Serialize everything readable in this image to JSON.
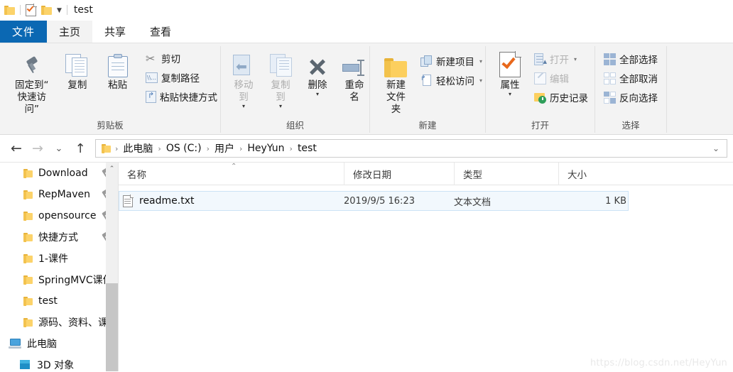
{
  "titlebar": {
    "title": "test",
    "icons": [
      "folder-icon",
      "properties-icon",
      "folder-icon",
      "dropdown-caret-icon"
    ],
    "caret": "▼"
  },
  "tabs": [
    {
      "label": "文件",
      "name": "tab-file",
      "active": false,
      "accent": "#0b68b3"
    },
    {
      "label": "主页",
      "name": "tab-home",
      "active": true
    },
    {
      "label": "共享",
      "name": "tab-share",
      "active": false
    },
    {
      "label": "查看",
      "name": "tab-view",
      "active": false
    }
  ],
  "ribbon": {
    "groups": [
      {
        "name": "剪贴板",
        "big": [
          {
            "label1": "固定到“",
            "label2": "快速访问”",
            "icon": "pin-icon"
          },
          {
            "label1": "复制",
            "label2": "",
            "icon": "copy-icon"
          },
          {
            "label1": "粘贴",
            "label2": "",
            "icon": "paste-icon"
          }
        ],
        "small": [
          {
            "label": "剪切",
            "icon": "scissors-icon"
          },
          {
            "label": "复制路径",
            "icon": "copy-path-icon"
          },
          {
            "label": "粘贴快捷方式",
            "icon": "paste-shortcut-icon"
          }
        ]
      },
      {
        "name": "组织",
        "big": [
          {
            "label1": "移动到",
            "label2": "",
            "icon": "move-to-icon",
            "dropdown": true,
            "dim": true
          },
          {
            "label1": "复制到",
            "label2": "",
            "icon": "copy-to-icon",
            "dropdown": true,
            "dim": true
          },
          {
            "label1": "删除",
            "label2": "",
            "icon": "delete-icon",
            "dropdown": true
          },
          {
            "label1": "重命名",
            "label2": "",
            "icon": "rename-icon"
          }
        ],
        "small": []
      },
      {
        "name": "新建",
        "big": [
          {
            "label1": "新建",
            "label2": "文件夹",
            "icon": "new-folder-icon"
          }
        ],
        "small": [
          {
            "label": "新建项目",
            "icon": "new-item-icon",
            "caret": "▾"
          },
          {
            "label": "轻松访问",
            "icon": "easy-access-icon",
            "caret": "▾"
          }
        ]
      },
      {
        "name": "打开",
        "big": [
          {
            "label1": "属性",
            "label2": "",
            "icon": "properties-icon",
            "dropdown": true
          }
        ],
        "small": [
          {
            "label": "打开",
            "icon": "open-icon",
            "caret": "▾",
            "dim": true
          },
          {
            "label": "编辑",
            "icon": "edit-icon",
            "dim": true
          },
          {
            "label": "历史记录",
            "icon": "history-icon"
          }
        ]
      },
      {
        "name": "选择",
        "big": [],
        "small": [
          {
            "label": "全部选择",
            "icon": "select-all-icon"
          },
          {
            "label": "全部取消",
            "icon": "select-none-icon"
          },
          {
            "label": "反向选择",
            "icon": "invert-selection-icon"
          }
        ]
      }
    ]
  },
  "address": {
    "back": "←",
    "forward": "→",
    "recent": "⌄",
    "up": "↑",
    "crumbs": [
      "此电脑",
      "OS (C:)",
      "用户",
      "HeyYun",
      "test"
    ],
    "separator": "›",
    "caret": "⌄"
  },
  "nav_pane": {
    "items": [
      {
        "label": "Download",
        "icon": "folder-icon",
        "pinned": true
      },
      {
        "label": "RepMaven",
        "icon": "folder-icon",
        "pinned": true
      },
      {
        "label": "opensource",
        "icon": "folder-icon",
        "pinned": true
      },
      {
        "label": "快捷方式",
        "icon": "folder-icon",
        "pinned": true
      },
      {
        "label": "1-课件",
        "icon": "folder-icon",
        "pinned": false
      },
      {
        "label": "SpringMVC课件",
        "icon": "folder-icon",
        "pinned": false
      },
      {
        "label": "test",
        "icon": "folder-icon",
        "pinned": false
      },
      {
        "label": "源码、资料、课件",
        "icon": "folder-icon",
        "pinned": false
      }
    ],
    "roots": [
      {
        "label": "此电脑",
        "icon": "this-pc-icon"
      },
      {
        "label": "3D 对象",
        "icon": "3d-objects-icon"
      }
    ],
    "scroll_up": "⌃"
  },
  "file_list": {
    "columns": [
      "名称",
      "修改日期",
      "类型",
      "大小"
    ],
    "sort_indicator": "⌃",
    "rows": [
      {
        "name": "readme.txt",
        "date": "2019/9/5 16:23",
        "type": "文本文档",
        "size": "1 KB",
        "icon": "text-file-icon",
        "selected": true
      }
    ]
  },
  "watermark": "https://blog.csdn.net/HeyYun"
}
